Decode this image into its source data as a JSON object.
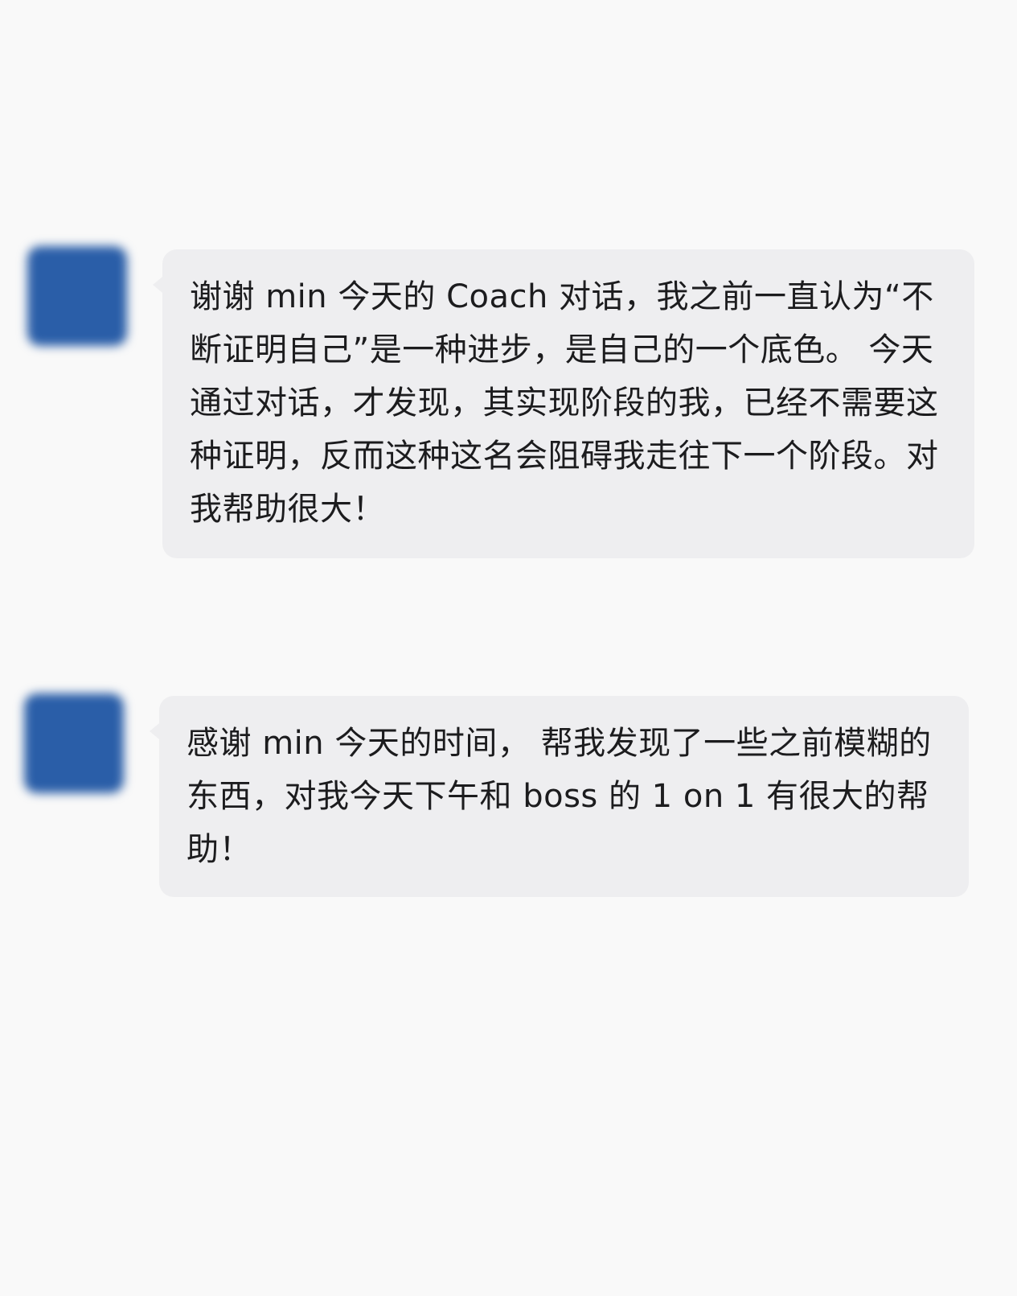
{
  "messages": [
    {
      "avatar_color": "#2a5ea8",
      "text": "谢谢 min 今天的 Coach 对话，我之前一直认为“不断证明自己”是一种进步，是自己的一个底色。 今天通过对话，才发现，其实现阶段的我，已经不需要这种证明，反而这种这名会阻碍我走往下一个阶段。对我帮助很大！"
    },
    {
      "avatar_color": "#2a5ea8",
      "text": "感谢 min 今天的时间， 帮我发现了一些之前模糊的东西，对我今天下午和 boss 的 1 on 1 有很大的帮助！"
    }
  ],
  "colors": {
    "background": "#f9f9f9",
    "bubble": "#eeeef0",
    "text": "#1c1c1e"
  }
}
